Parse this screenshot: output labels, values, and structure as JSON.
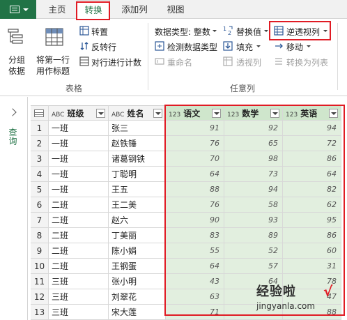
{
  "tabs": [
    {
      "label": "主页"
    },
    {
      "label": "转换"
    },
    {
      "label": "添加列"
    },
    {
      "label": "视图"
    }
  ],
  "ribbon": {
    "group_table": {
      "label": "表格",
      "group_by": "分组\n依据",
      "first_row_header": "将第一行\n用作标题",
      "transpose": "转置",
      "reverse_rows": "反转行",
      "count_rows": "对行进行计数"
    },
    "group_any_column": {
      "label": "任意列",
      "data_type": "数据类型: 整数",
      "detect_type": "检测数据类型",
      "rename": "重命名",
      "replace_values": "替换值",
      "fill": "填充",
      "pivot_column": "透视列",
      "unpivot_column": "逆透视列",
      "move": "移动",
      "convert_to_list": "转换为列表"
    }
  },
  "query_pane": {
    "label": "查询"
  },
  "table": {
    "columns": [
      {
        "name": "班级",
        "type": "ABC"
      },
      {
        "name": "姓名",
        "type": "ABC"
      },
      {
        "name": "语文",
        "type": "123"
      },
      {
        "name": "数学",
        "type": "123"
      },
      {
        "name": "英语",
        "type": "123"
      }
    ],
    "rows": [
      {
        "index": "1",
        "cls": "一班",
        "name": "张三",
        "chinese": "91",
        "math": "92",
        "english": "94"
      },
      {
        "index": "2",
        "cls": "一班",
        "name": "赵铁锤",
        "chinese": "76",
        "math": "65",
        "english": "72"
      },
      {
        "index": "3",
        "cls": "一班",
        "name": "诸葛钢铁",
        "chinese": "70",
        "math": "98",
        "english": "86"
      },
      {
        "index": "4",
        "cls": "一班",
        "name": "丁聪明",
        "chinese": "64",
        "math": "73",
        "english": "64"
      },
      {
        "index": "5",
        "cls": "一班",
        "name": "王五",
        "chinese": "88",
        "math": "94",
        "english": "82"
      },
      {
        "index": "6",
        "cls": "二班",
        "name": "王二美",
        "chinese": "76",
        "math": "58",
        "english": "62"
      },
      {
        "index": "7",
        "cls": "二班",
        "name": "赵六",
        "chinese": "90",
        "math": "93",
        "english": "95"
      },
      {
        "index": "8",
        "cls": "二班",
        "name": "丁美丽",
        "chinese": "83",
        "math": "89",
        "english": "86"
      },
      {
        "index": "9",
        "cls": "二班",
        "name": "陈小娟",
        "chinese": "55",
        "math": "52",
        "english": "60"
      },
      {
        "index": "10",
        "cls": "二班",
        "name": "王钢蛋",
        "chinese": "64",
        "math": "57",
        "english": "31"
      },
      {
        "index": "11",
        "cls": "三班",
        "name": "张小明",
        "chinese": "43",
        "math": "64",
        "english": "78"
      },
      {
        "index": "12",
        "cls": "三班",
        "name": "刘翠花",
        "chinese": "63",
        "math": "",
        "english": "47"
      },
      {
        "index": "13",
        "cls": "三班",
        "name": "宋大莲",
        "chinese": "71",
        "math": "",
        "english": "88"
      }
    ]
  },
  "watermark": {
    "line1": "经验啦",
    "line2": "jingyanla.com",
    "check": "√"
  },
  "colors": {
    "accent": "#217346",
    "highlight": "#e01b24",
    "selected_column": "#e2efdf"
  }
}
